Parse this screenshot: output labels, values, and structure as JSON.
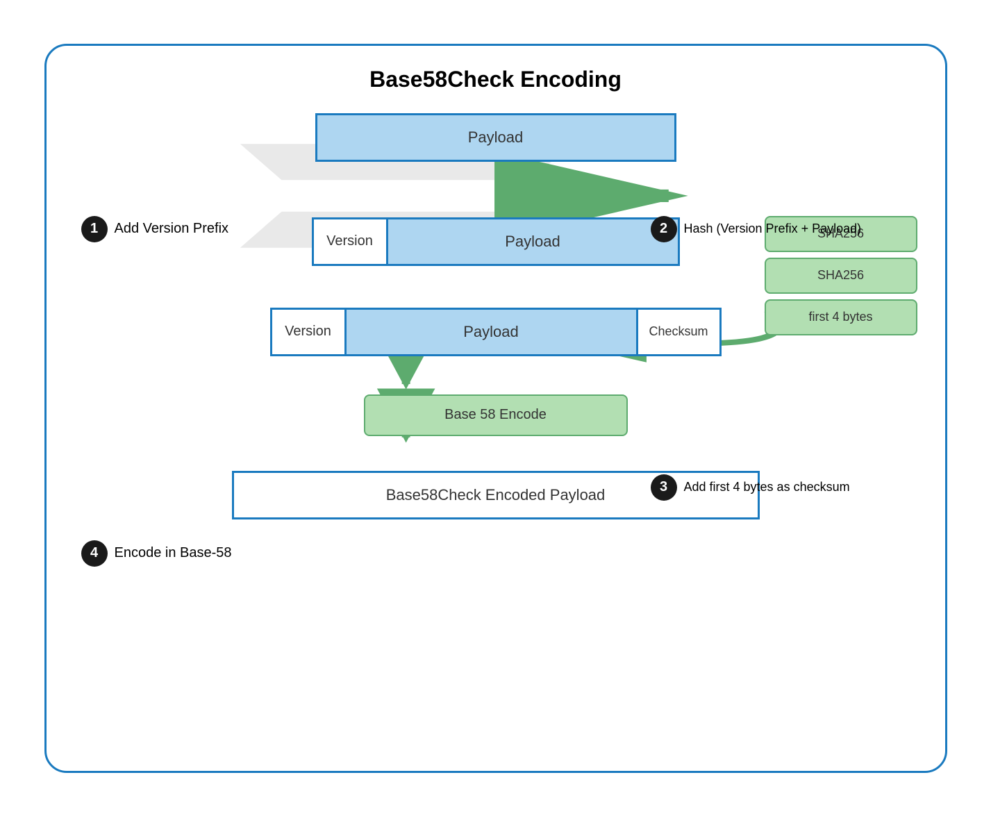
{
  "title": "Base58Check Encoding",
  "steps": [
    {
      "number": "1",
      "label": "Add Version Prefix"
    },
    {
      "number": "2",
      "label": "Hash (Version Prefix + Payload)"
    },
    {
      "number": "3",
      "label": "Add first 4 bytes as checksum"
    },
    {
      "number": "4",
      "label": "Encode in Base-58"
    }
  ],
  "boxes": {
    "payload_top": "Payload",
    "version": "Version",
    "payload_mid": "Payload",
    "payload_bottom": "Payload",
    "checksum": "Checksum",
    "sha1": "SHA256",
    "sha2": "SHA256",
    "first_bytes": "first 4 bytes",
    "base58_encode": "Base 58 Encode",
    "final": "Base58Check Encoded Payload"
  }
}
